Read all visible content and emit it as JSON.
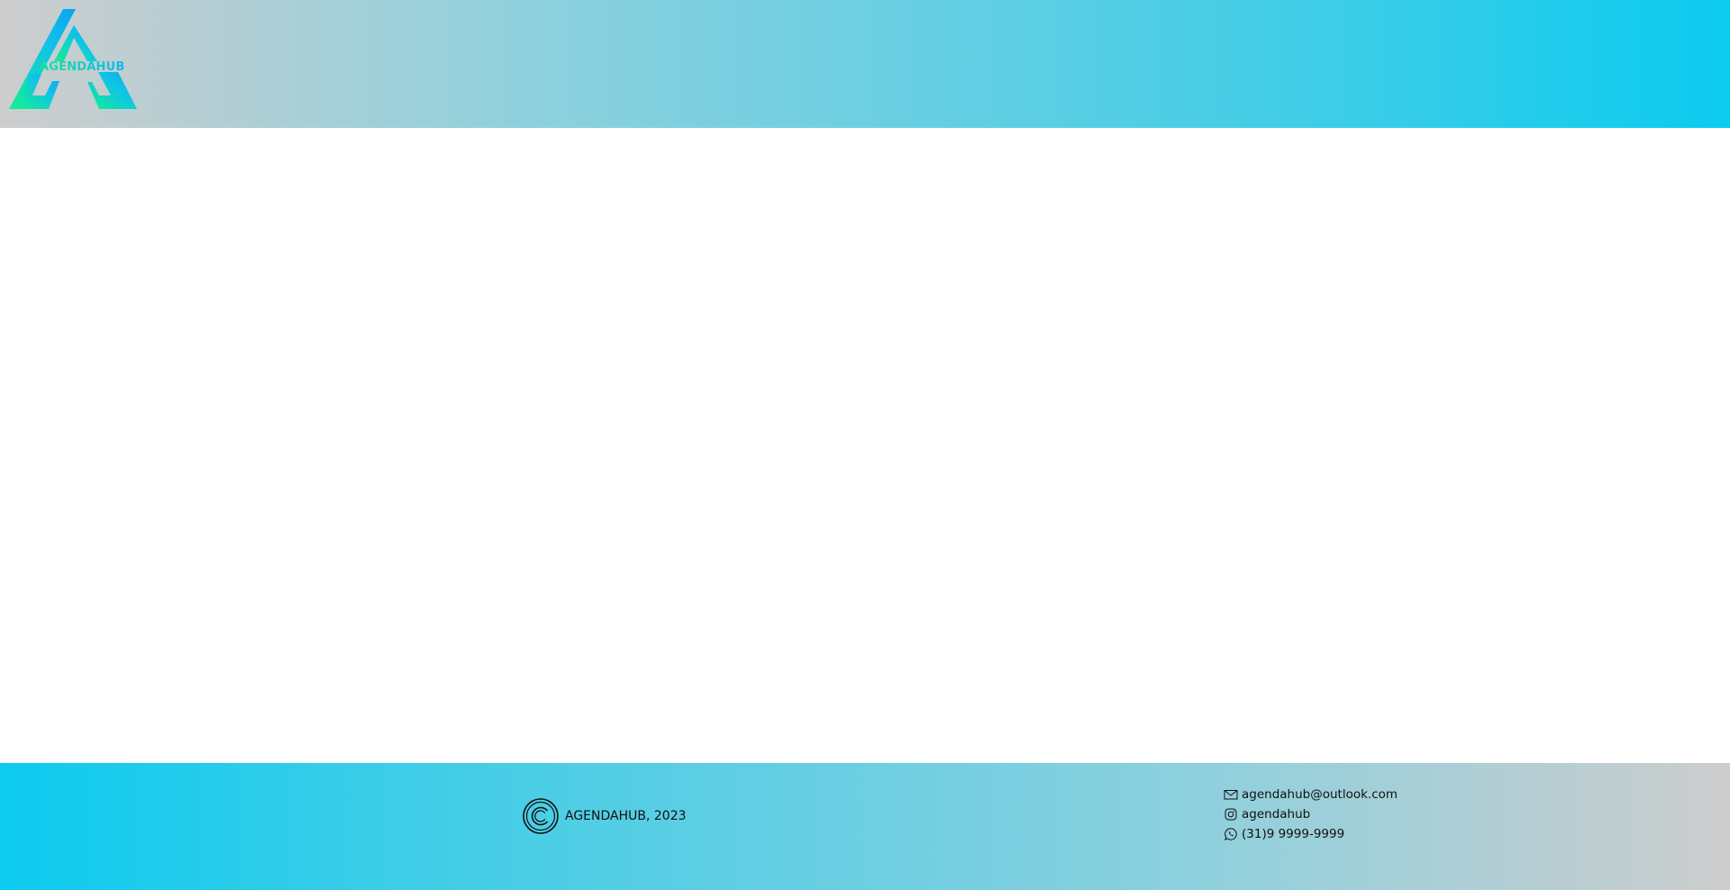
{
  "header": {
    "logo_text": "AGENDAHUB"
  },
  "menu": {
    "icon": "hamburger-menu-icon"
  },
  "footer": {
    "copyright_icon": "copyright-icon",
    "copyright_text": "AGENDAHUB, 2023",
    "contacts": [
      {
        "icon": "mail-icon",
        "text": "agendahub@outlook.com"
      },
      {
        "icon": "instagram-icon",
        "text": "agendahub"
      },
      {
        "icon": "whatsapp-icon",
        "text": "(31)9 9999-9999"
      }
    ]
  },
  "colors": {
    "gradient_gray": "#cdcdcd",
    "gradient_cyan": "#0ccbef",
    "logo_green": "#19e39a",
    "logo_blue": "#10b8f0"
  }
}
